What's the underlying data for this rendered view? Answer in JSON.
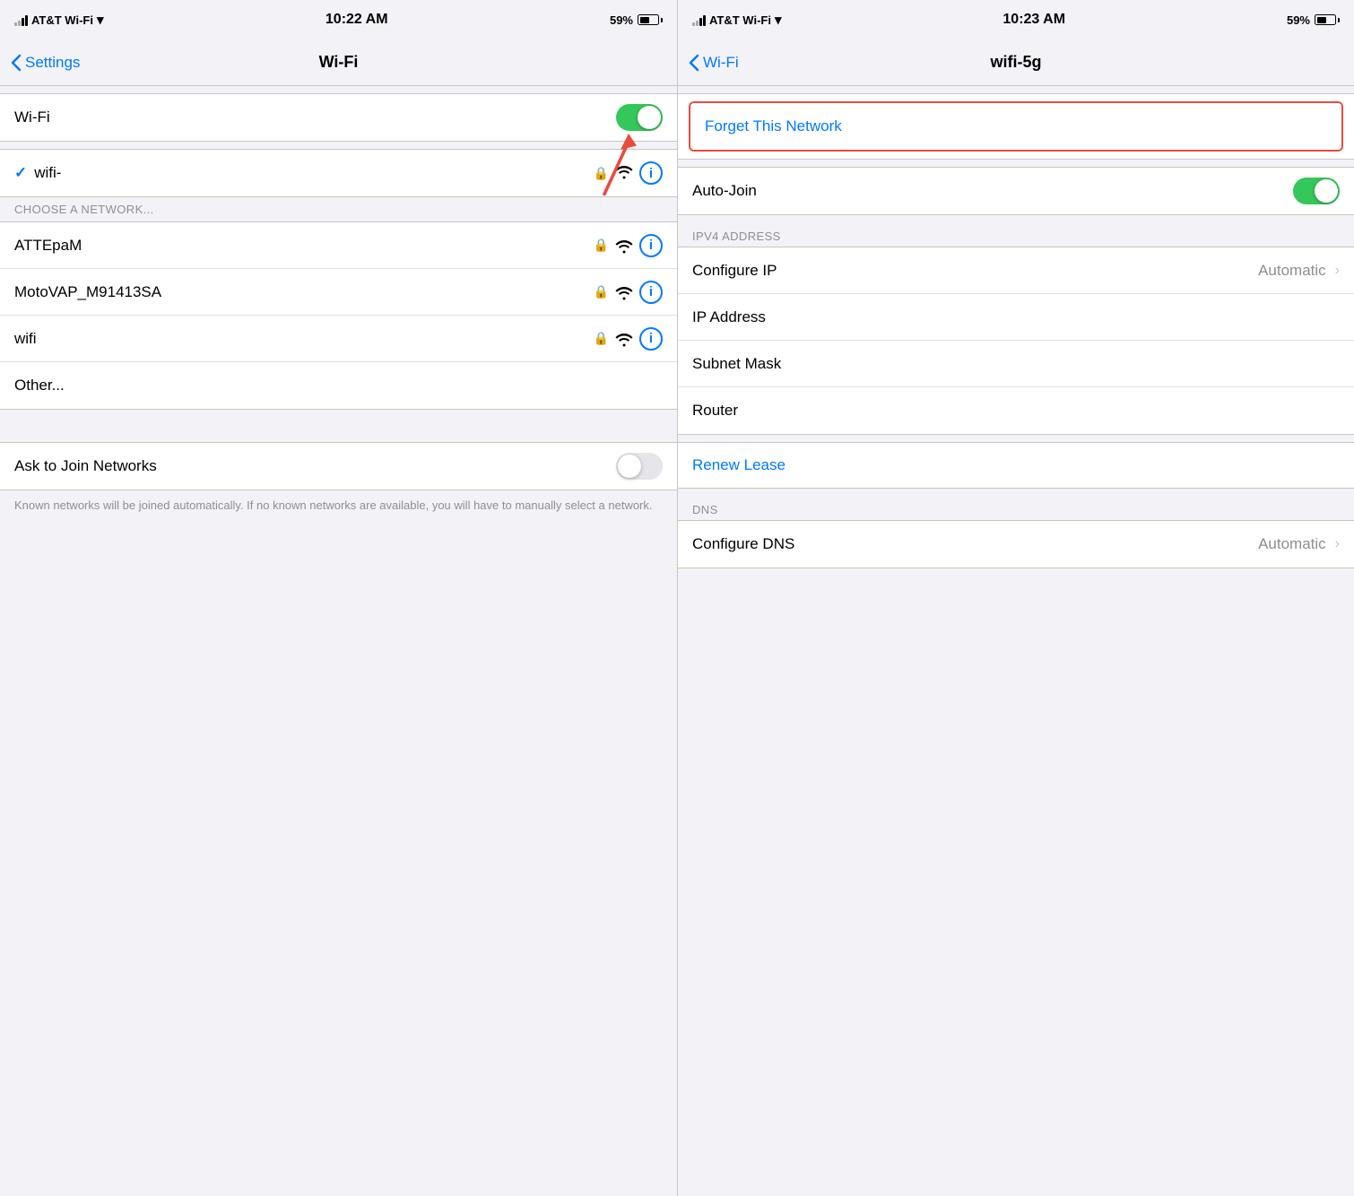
{
  "left_panel": {
    "status_bar": {
      "carrier": "AT&T Wi-Fi",
      "time": "10:22 AM",
      "battery": "59%"
    },
    "nav": {
      "back_label": "Settings",
      "title": "Wi-Fi"
    },
    "wifi_row": {
      "label": "Wi-Fi",
      "toggle_state": "on"
    },
    "connected_network": {
      "name": "wifi-",
      "checkmark": "✓"
    },
    "choose_header": "CHOOSE A NETWORK...",
    "networks": [
      {
        "name": "ATTEpaM"
      },
      {
        "name": "MotoVAP_M91413SA"
      },
      {
        "name": "wifi"
      },
      {
        "name": "Other..."
      }
    ],
    "ask_join": {
      "label": "Ask to Join Networks",
      "toggle_state": "off"
    },
    "footer_note": "Known networks will be joined automatically. If no known networks are available, you will have to manually select a network."
  },
  "right_panel": {
    "status_bar": {
      "carrier": "AT&T Wi-Fi",
      "time": "10:23 AM",
      "battery": "59%"
    },
    "nav": {
      "back_label": "Wi-Fi",
      "title": "wifi-5g"
    },
    "forget_label": "Forget This Network",
    "auto_join": {
      "label": "Auto-Join",
      "toggle_state": "on"
    },
    "ipv4_header": "IPV4 ADDRESS",
    "ipv4_rows": [
      {
        "label": "Configure IP",
        "value": "Automatic",
        "chevron": true
      },
      {
        "label": "IP Address",
        "value": "",
        "chevron": false
      },
      {
        "label": "Subnet Mask",
        "value": "",
        "chevron": false
      },
      {
        "label": "Router",
        "value": "",
        "chevron": false
      }
    ],
    "renew_lease": "Renew Lease",
    "dns_header": "DNS",
    "dns_rows": [
      {
        "label": "Configure DNS",
        "value": "Automatic",
        "chevron": true
      }
    ]
  },
  "icons": {
    "info": "i",
    "lock": "🔒",
    "wifi_signal": "WiFi",
    "back_chevron": "‹"
  }
}
